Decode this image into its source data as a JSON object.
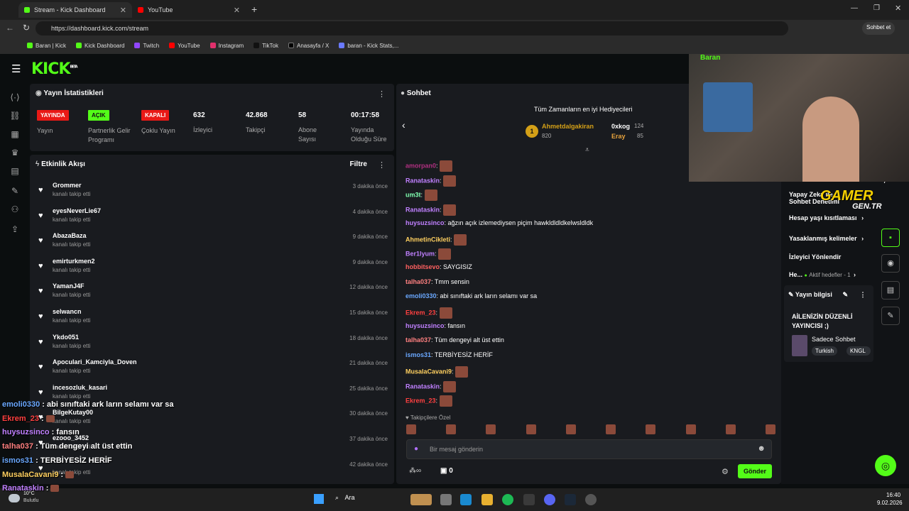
{
  "browser": {
    "tabs": [
      {
        "title": "Stream - Kick Dashboard"
      },
      {
        "title": "YouTube"
      }
    ],
    "url": "https://dashboard.kick.com/stream",
    "sidebar_btn": "Sohbet et",
    "bookmarks": [
      "Baran | Kick",
      "Kick Dashboard",
      "Twitch",
      "YouTube",
      "Instagram",
      "TikTok",
      "Anasayfa / X",
      "baran - Kick Stats,..."
    ]
  },
  "kick": {
    "logo": "KICK",
    "beta": "BETA"
  },
  "stats": {
    "title": "Yayın İstatistikleri",
    "items": [
      {
        "badge": "YAYINDA",
        "label": "Yayın",
        "color": "#e91916"
      },
      {
        "badge": "AÇIK",
        "label": "Partnerlik Gelir Programı",
        "color": "#53fc18"
      },
      {
        "badge": "KAPALI",
        "label": "Çoklu Yayın",
        "color": "#e91916"
      },
      {
        "value": "632",
        "label": "İzleyici"
      },
      {
        "value": "42.868",
        "label": "Takipçi"
      },
      {
        "value": "58",
        "label": "Abone Sayısı"
      },
      {
        "value": "00:17:58",
        "label": "Yayında Olduğu Süre"
      }
    ]
  },
  "activity": {
    "title": "Etkinlik Akışı",
    "filter": "Filtre",
    "items": [
      {
        "name": "Grommer",
        "desc": "kanalı takip etti",
        "time": "3 dakika önce"
      },
      {
        "name": "eyesNeverLie67",
        "desc": "kanalı takip etti",
        "time": "4 dakika önce"
      },
      {
        "name": "AbazaBaza",
        "desc": "kanalı takip etti",
        "time": "9 dakika önce"
      },
      {
        "name": "emirturkmen2",
        "desc": "kanalı takip etti",
        "time": "9 dakika önce"
      },
      {
        "name": "YamanJ4F",
        "desc": "kanalı takip etti",
        "time": "12 dakika önce"
      },
      {
        "name": "selwancn",
        "desc": "kanalı takip etti",
        "time": "15 dakika önce"
      },
      {
        "name": "Ykdo051",
        "desc": "kanalı takip etti",
        "time": "18 dakika önce"
      },
      {
        "name": "Apoculari_Kamciyla_Doven",
        "desc": "kanalı takip etti",
        "time": "21 dakika önce"
      },
      {
        "name": "incesozluk_kasari",
        "desc": "kanalı takip etti",
        "time": "25 dakika önce"
      },
      {
        "name": "BilgeKutay00",
        "desc": "kanalı takip etti",
        "time": "30 dakika önce"
      },
      {
        "name": "ezooo_3452",
        "desc": "kanalı takip etti",
        "time": "37 dakika önce"
      },
      {
        "name": "",
        "desc": "kanalı takip etti",
        "time": "42 dakika önce"
      }
    ]
  },
  "chat": {
    "title": "Sohbet",
    "gifters_title": "Tüm Zamanların en iyi Hediyecileri",
    "gifters": [
      {
        "rank": "1",
        "name": "Ahmetdalgakiran",
        "count": "820"
      },
      {
        "name": "0xkog",
        "count": "124"
      },
      {
        "name": "Eray",
        "count": "85"
      }
    ],
    "messages": [
      {
        "user": "amorpan0",
        "text": "",
        "color": "#b03080"
      },
      {
        "user": "Ranataskin",
        "text": "",
        "color": "#c080ff"
      },
      {
        "user": "um3t",
        "text": "",
        "color": "#80ffb0"
      },
      {
        "user": "Ranataskin",
        "text": "",
        "color": "#c080ff"
      },
      {
        "user": "huysuzsinco",
        "text": "ağzın açık izlemediysen piçim hawkldldldkelwsldldk",
        "color": "#c080ff"
      },
      {
        "user": "AhmetinCikleti",
        "text": "",
        "color": "#ffd060"
      },
      {
        "user": "Ber1lyum",
        "text": "",
        "color": "#c080ff"
      },
      {
        "user": "hobbitsevo",
        "text": "SAYGISIZ",
        "color": "#ff6060"
      },
      {
        "user": "talha037",
        "text": "Tmm sensin",
        "color": "#ff8080"
      },
      {
        "user": "emoli0330",
        "text": "abi sınıftaki ark ların selamı var sa",
        "color": "#6aa8ff"
      },
      {
        "user": "Ekrem_23",
        "text": "",
        "color": "#ff4040"
      },
      {
        "user": "huysuzsinco",
        "text": "fansın",
        "color": "#c080ff"
      },
      {
        "user": "talha037",
        "text": "Tüm dengeyi alt üst ettin",
        "color": "#ff8080"
      },
      {
        "user": "ismos31",
        "text": "TERBİYESİZ HERİF",
        "color": "#6aa8ff"
      },
      {
        "user": "MusalaCavani9",
        "text": "",
        "color": "#ffd060"
      },
      {
        "user": "Ranataskin",
        "text": "",
        "color": "#c080ff"
      },
      {
        "user": "Ekrem_23",
        "text": "",
        "color": "#ff4040"
      }
    ],
    "followers_label": "Takipçilere Özel",
    "input_placeholder": "Bir mesaj gönderin",
    "points": "0",
    "send": "Gönder"
  },
  "right": {
    "items": [
      "Yapay Zeka ile Sohbet Denetimi",
      "Hesap yaşı kısıtlaması",
      "Yasaklanmış kelimeler",
      "İzleyici Yönlendir",
      "He...",
      "Aktif hedefler - 1"
    ],
    "stream_info_title": "Yayın bilgisi",
    "stream_title": "AİLENİZİN DÜZENLİ YAYINCISI ;)",
    "category": "Sadece Sohbet",
    "tags": [
      "Turkish",
      "KNGL"
    ]
  },
  "overlay": {
    "cam_name": "Baran",
    "watermark": "GAMER",
    "watermark_sub": "GEN.TR",
    "chat": [
      {
        "user": "emoli0330",
        "text": "abi sınıftaki ark ların selamı var sa",
        "color": "#6aa8ff"
      },
      {
        "user": "Ekrem_23",
        "text": "",
        "color": "#ff4040"
      },
      {
        "user": "huysuzsinco",
        "text": "fansın",
        "color": "#c080ff"
      },
      {
        "user": "talha037",
        "text": "Tüm dengeyi alt üst ettin",
        "color": "#ff8080"
      },
      {
        "user": "ismos31",
        "text": "TERBİYESİZ HERİF",
        "color": "#6aa8ff"
      },
      {
        "user": "MusalaCavani9",
        "text": "",
        "color": "#ffd060"
      },
      {
        "user": "Ranataskin",
        "text": "",
        "color": "#c080ff"
      }
    ]
  },
  "taskbar": {
    "temp": "10°C",
    "weather": "Bulutlu",
    "search": "Ara",
    "time": "16:40",
    "date": "9.02.2026"
  }
}
